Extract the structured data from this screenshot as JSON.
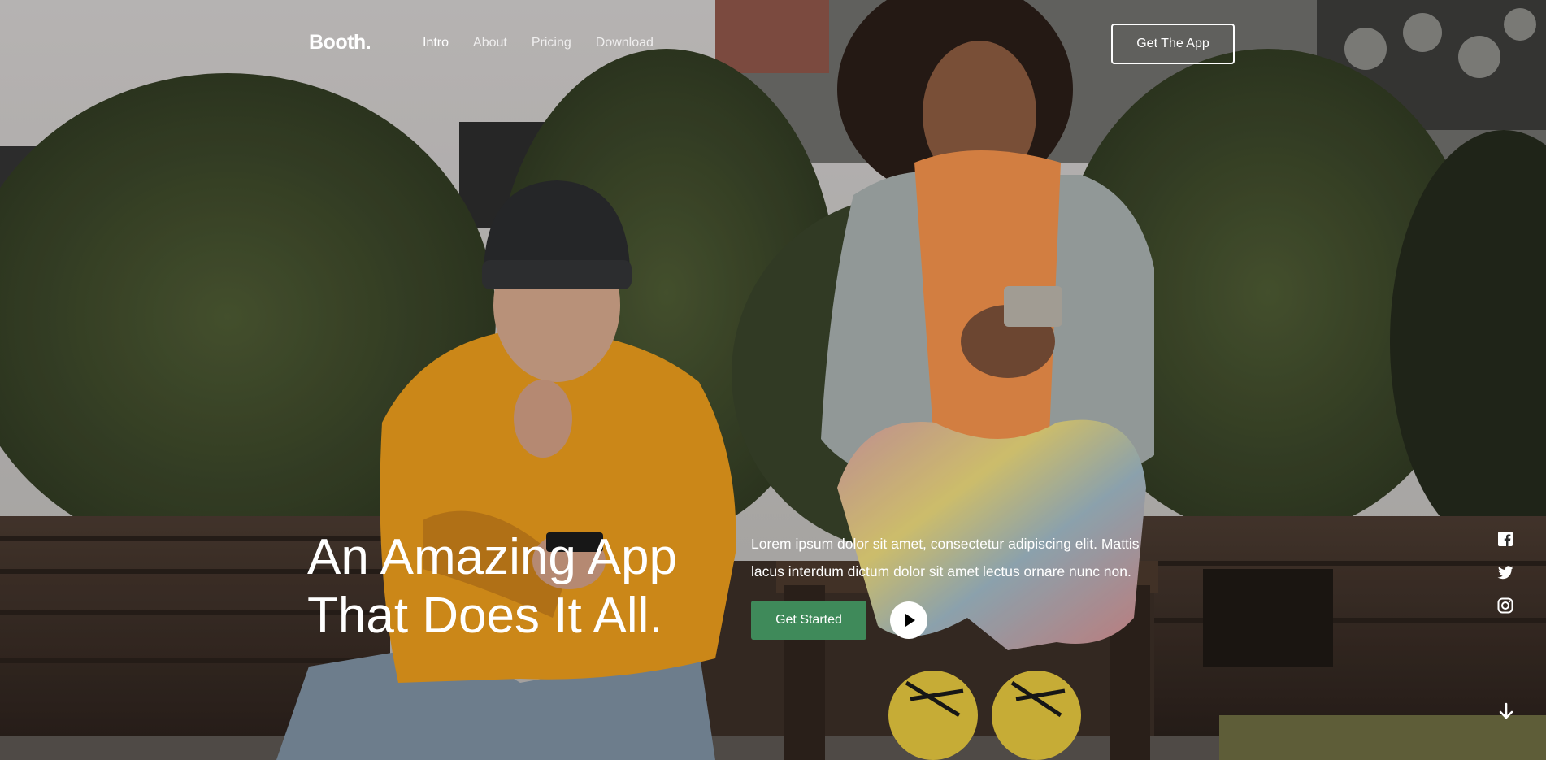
{
  "brand": {
    "logo": "Booth."
  },
  "nav": {
    "items": [
      {
        "label": "Intro",
        "active": true
      },
      {
        "label": "About",
        "active": false
      },
      {
        "label": "Pricing",
        "active": false
      },
      {
        "label": "Download",
        "active": false
      }
    ]
  },
  "header": {
    "cta_label": "Get The App"
  },
  "hero": {
    "headline_line1": "An Amazing App",
    "headline_line2": "That Does It All.",
    "lead_line1": "Lorem ipsum dolor sit amet, consectetur adipiscing elit. Mattis",
    "lead_line2": "lacus interdum dictum dolor sit amet lectus ornare nunc non.",
    "primary_button": "Get Started",
    "play_icon": "play-icon"
  },
  "social": {
    "icons": [
      "facebook-icon",
      "twitter-icon",
      "instagram-icon"
    ]
  },
  "scroll": {
    "icon": "arrow-down-icon"
  },
  "colors": {
    "accent_green": "#3f8a5a",
    "text": "#ffffff",
    "sweatshirt_orange": "#e89a1c",
    "hoodie_orange": "#f0904a",
    "foliage_green": "#3f4a2a"
  }
}
